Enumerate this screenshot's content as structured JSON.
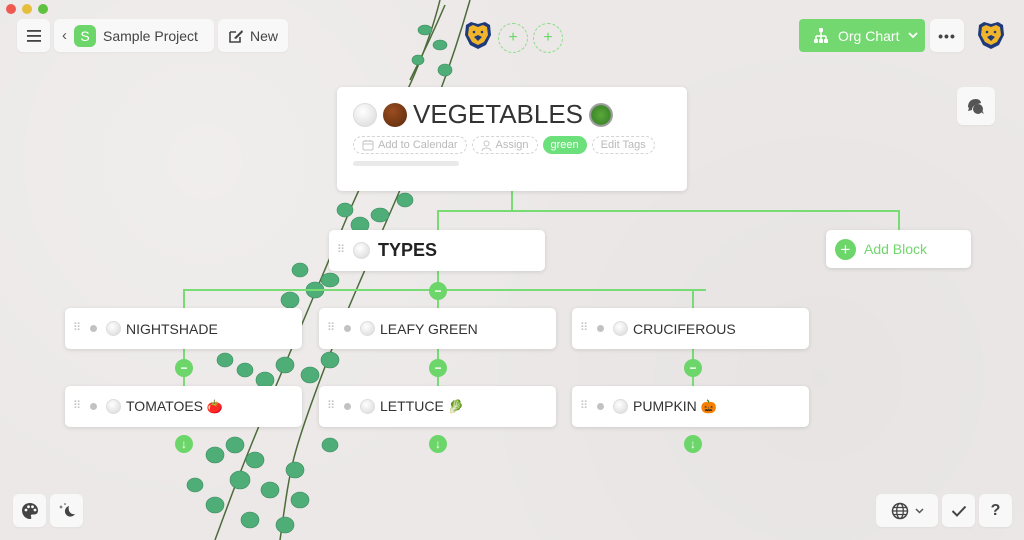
{
  "window": {
    "traffic_lights": [
      "close",
      "minimize",
      "maximize"
    ]
  },
  "toolbar": {
    "menu_icon": "hamburger-icon",
    "back_icon": "chevron-left-icon",
    "project_badge": "S",
    "project_name": "Sample Project",
    "new_label": "New",
    "new_icon": "compose-icon",
    "add_collaborator_symbol": "+",
    "view_label": "Org Chart",
    "view_icon": "org-chart-icon",
    "view_dropdown_icon": "chevron-down-icon",
    "more_label": "•••",
    "comment_icon": "comments-icon"
  },
  "root_block": {
    "status_icons": [
      "white-circle",
      "brown-circle"
    ],
    "title": "VEGETABLES",
    "title_emoji": "salad",
    "chips": {
      "calendar": "Add to Calendar",
      "assign": "Assign",
      "tag": "green",
      "edit_tags": "Edit Tags"
    },
    "progress": 0
  },
  "tree": {
    "types": {
      "label": "TYPES"
    },
    "add_block_label": "Add Block",
    "add_block_symbol": "+",
    "collapse_symbol": "−",
    "expand_symbol": "↓",
    "categories": [
      {
        "label": "NIGHTSHADE",
        "child": {
          "label": "TOMATOES",
          "emoji": "🍅"
        }
      },
      {
        "label": "LEAFY GREEN",
        "child": {
          "label": "LETTUCE",
          "emoji": "🥬"
        }
      },
      {
        "label": "CRUCIFEROUS",
        "child": {
          "label": "PUMPKIN",
          "emoji": "🎃"
        }
      }
    ]
  },
  "bottom": {
    "palette_icon": "palette-icon",
    "night_icon": "moon-stars-icon",
    "language_icon": "globe-icon",
    "check_icon": "check-icon",
    "help_label": "?"
  },
  "colors": {
    "accent": "#74d870",
    "tag_green": "#6ce07a",
    "background": "#ebe8e7"
  }
}
